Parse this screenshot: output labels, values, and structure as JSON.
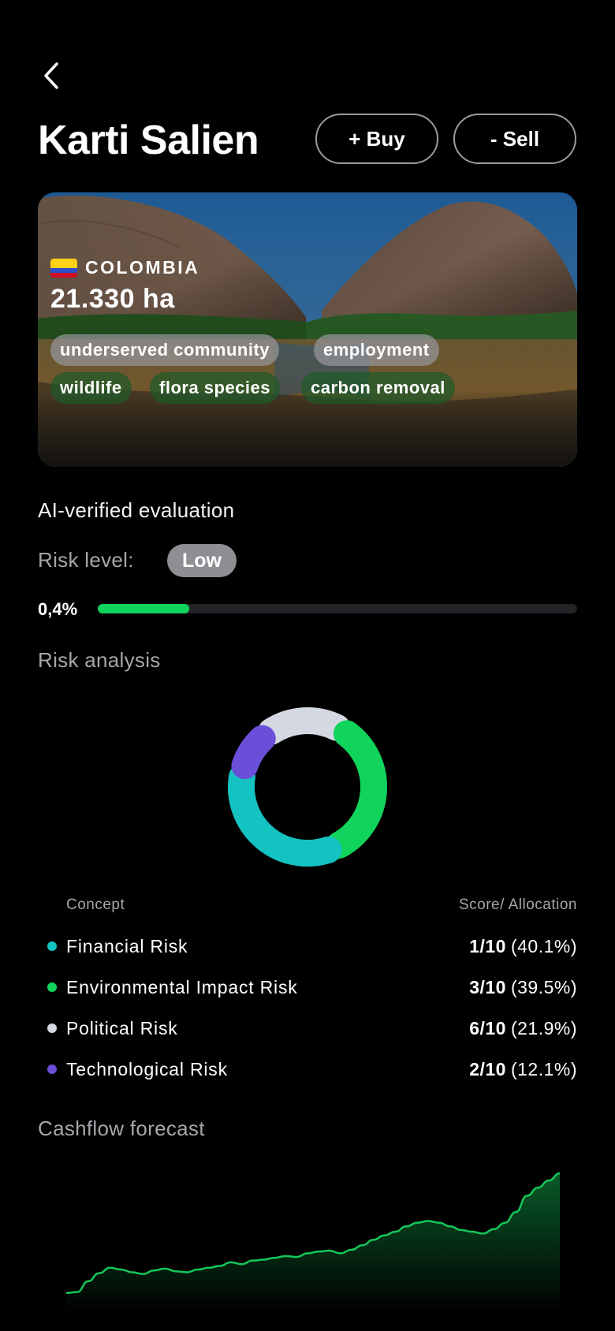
{
  "header": {
    "back_icon": "chevron-left-icon",
    "title": "Karti Salien",
    "buy_label": "+ Buy",
    "sell_label": "- Sell"
  },
  "hero": {
    "country": "COLOMBIA",
    "flag_colors": [
      "#fcd116",
      "#2b4fc7",
      "#ce1126"
    ],
    "area": "21.330 ha",
    "tags": [
      {
        "label": "underserved community",
        "style": "gray"
      },
      {
        "label": "employment",
        "style": "gray"
      },
      {
        "label": "wildlife",
        "style": "green"
      },
      {
        "label": "flora species",
        "style": "green"
      },
      {
        "label": "carbon removal",
        "style": "green"
      }
    ]
  },
  "evaluation": {
    "heading": "AI-verified evaluation",
    "risk_level_label": "Risk level:",
    "risk_level": "Low",
    "risk_percent": "0,4%",
    "progress_fraction": 0.19,
    "progress_color": "#10d45c"
  },
  "risk_analysis": {
    "heading": "Risk analysis",
    "col_concept": "Concept",
    "col_score": "Score/ Allocation",
    "rows": [
      {
        "name": "Financial Risk",
        "score": "1/10",
        "alloc": "(40.1%)",
        "color": "#14c2c2"
      },
      {
        "name": "Environmental Impact Risk",
        "score": "3/10",
        "alloc": "(39.5%)",
        "color": "#10d45c"
      },
      {
        "name": "Political Risk",
        "score": "6/10",
        "alloc": "(21.9%)",
        "color": "#d4d8e2"
      },
      {
        "name": "Technological Risk",
        "score": "2/10",
        "alloc": "(12.1%)",
        "color": "#6a4fd8"
      }
    ]
  },
  "chart_data": {
    "type": "pie",
    "categories": [
      "Financial Risk",
      "Environmental Impact Risk",
      "Political Risk",
      "Technological Risk"
    ],
    "values": [
      40.1,
      39.5,
      21.9,
      12.1
    ],
    "colors": [
      "#14c2c2",
      "#10d45c",
      "#d4d8e2",
      "#6a4fd8"
    ]
  },
  "cashflow": {
    "heading": "Cashflow forecast",
    "line_color": "#14c85a",
    "values": [
      2,
      3,
      15,
      24,
      30,
      28,
      25,
      23,
      27,
      29,
      26,
      25,
      28,
      30,
      32,
      36,
      34,
      38,
      39,
      41,
      43,
      42,
      46,
      48,
      49,
      46,
      50,
      55,
      61,
      66,
      70,
      76,
      80,
      82,
      80,
      76,
      72,
      70,
      68,
      73,
      80,
      92,
      110,
      119,
      127,
      135
    ]
  }
}
